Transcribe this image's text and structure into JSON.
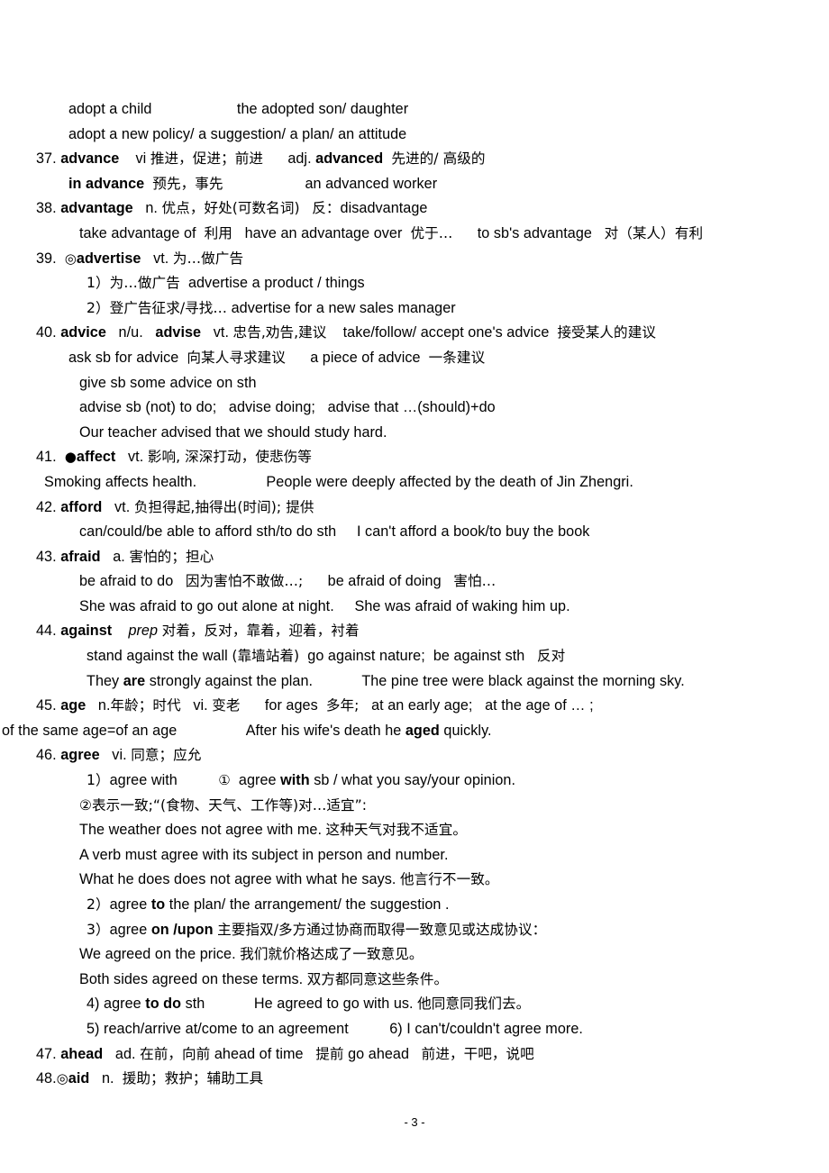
{
  "document": {
    "title": "English Vocabulary Notes",
    "page_label": "- 3 -",
    "entry_range": "37-48"
  },
  "lines": [
    {
      "id": "l01",
      "indent": 2,
      "text": "adopt a child                      the adopted son/ daughter"
    },
    {
      "id": "l02",
      "indent": 2,
      "text": "adopt a new policy/ a suggestion/ a plan/ an attitude"
    },
    {
      "id": "l03",
      "indent": 0,
      "text": "37. advance    vi 推进，促进；前进        adj. advanced  先进的/ 高级的"
    },
    {
      "id": "l04",
      "indent": 2,
      "text": "in advance  预先，事先                    an advanced worker"
    },
    {
      "id": "l05",
      "indent": 0,
      "text": "38. advantage   n. 优点，好处(可数名词)    反：disadvantage"
    },
    {
      "id": "l06",
      "indent": 3,
      "text": "take advantage of  利用   have an advantage over  优于…      to sb's advantage   对（某人）有利"
    },
    {
      "id": "l07",
      "indent": 0,
      "text": "39. ◎advertise   vt. 为…做广告"
    },
    {
      "id": "l08",
      "indent": 4,
      "text": "1）为…做广告  advertise a product / things"
    },
    {
      "id": "l09",
      "indent": 4,
      "text": "2）登广告征求/寻找… advertise for a new sales manager"
    },
    {
      "id": "l10",
      "indent": 0,
      "text": "40. advice   n/u.   advise   vt. 忠告,劝告,建议    take/follow/ accept one's advice  接受某人的建议"
    },
    {
      "id": "l11",
      "indent": 2,
      "text": "ask sb for advice  向某人寻求建议      a piece of advice  一条建议"
    },
    {
      "id": "l12",
      "indent": 3,
      "text": "give sb some advice on sth"
    },
    {
      "id": "l13",
      "indent": 3,
      "text": "advise sb (not) to do;   advise doing;   advise that …(should)+do"
    },
    {
      "id": "l14",
      "indent": 3,
      "text": "Our teacher advised that we should study hard."
    },
    {
      "id": "l15",
      "indent": 0,
      "text": "41.  ●affect   vt. 影响, 深深打动，使悲伤等"
    },
    {
      "id": "l16",
      "indent": 1,
      "text": "Smoking affects health.                 People were deeply affected by the death of Jin Zhengri."
    },
    {
      "id": "l17",
      "indent": 0,
      "text": "42. afford   vt. 负担得起,抽得出(时间); 提供"
    },
    {
      "id": "l18",
      "indent": 3,
      "text": "can/could/be able to afford sth/to do sth     I can't afford a book/to buy the book"
    },
    {
      "id": "l19",
      "indent": 0,
      "text": "43. afraid   a. 害怕的；担心"
    },
    {
      "id": "l20",
      "indent": 3,
      "text": "be afraid to do   因为害怕不敢做…;      be afraid of doing   害怕…"
    },
    {
      "id": "l21",
      "indent": 3,
      "text": "She was afraid to go out alone at night.     She was afraid of waking him up."
    },
    {
      "id": "l22",
      "indent": 0,
      "text": "44. against    prep 对着，反对，靠着，迎着，衬着"
    },
    {
      "id": "l23",
      "indent": 4,
      "text": "stand against the wall (靠墙站着)  go against nature;  be against sth   反对"
    },
    {
      "id": "l24",
      "indent": 4,
      "text": "They are strongly against the plan.            The pine tree were black against the morning sky."
    },
    {
      "id": "l25",
      "indent": 0,
      "text": "45. age   n.年龄；时代   vi. 变老      for ages  多年;   at an early age;   at the age of … ;"
    },
    {
      "id": "l26",
      "indent": -1,
      "text": "of the same age=of an age                 After his wife's death he aged quickly."
    },
    {
      "id": "l27",
      "indent": 0,
      "text": "46. agree   vi. 同意；应允"
    },
    {
      "id": "l28",
      "indent": 4,
      "text": "1）agree with          ①  agree with sb / what you say/your opinion."
    },
    {
      "id": "l29",
      "indent": 3,
      "text": "②表示一致;“(食物、天气、工作等)对…适宜”:"
    },
    {
      "id": "l30",
      "indent": 3,
      "text": "The weather does not agree with me. 这种天气对我不适宜。"
    },
    {
      "id": "l31",
      "indent": 3,
      "text": "A verb must agree with its subject in person and number."
    },
    {
      "id": "l32",
      "indent": 3,
      "text": "What he does does not agree with what he says. 他言行不一致。"
    },
    {
      "id": "l33",
      "indent": 4,
      "text": "2）agree to the plan/ the arrangement/ the suggestion ."
    },
    {
      "id": "l34",
      "indent": 4,
      "text": "3）agree on /upon 主要指双/多方通过协商而取得一致意见或达成协议："
    },
    {
      "id": "l35",
      "indent": 3,
      "text": "We agreed on the price. 我们就价格达成了一致意见。"
    },
    {
      "id": "l36",
      "indent": 3,
      "text": "Both sides agreed on these terms. 双方都同意这些条件。"
    },
    {
      "id": "l37",
      "indent": 4,
      "text": "4) agree to do sth            He agreed to go with us. 他同意同我们去。"
    },
    {
      "id": "l38",
      "indent": 4,
      "text": "5) reach/arrive at/come to an agreement          6) I can't/couldn't agree more."
    },
    {
      "id": "l39",
      "indent": 0,
      "text": "47. ahead   ad. 在前，向前 ahead of time   提前 go ahead   前进，干吧，说吧"
    },
    {
      "id": "l40",
      "indent": 0,
      "text": "48.◎aid   n.  援助；救护；辅助工具"
    }
  ],
  "entries": [
    {
      "number": "37",
      "headword": "advance",
      "pos": "vi",
      "meaning_cn": "推进，促进；前进",
      "extras": [
        "adj. advanced  先进的/ 高级的",
        "in advance  预先，事先",
        "an advanced worker"
      ]
    },
    {
      "number": "38",
      "headword": "advantage",
      "pos": "n.",
      "meaning_cn": "优点，好处(可数名词)",
      "extras": [
        "反：disadvantage",
        "take advantage of  利用",
        "have an advantage over  优于…",
        "to sb's advantage  对（某人）有利"
      ]
    },
    {
      "number": "39",
      "headword": "advertise",
      "marker": "◎",
      "pos": "vt.",
      "meaning_cn": "为…做广告",
      "extras": [
        "1）为…做广告  advertise a product / things",
        "2）登广告征求/寻找… advertise for a new sales manager"
      ]
    },
    {
      "number": "40",
      "headword": "advice",
      "pos": "n/u.",
      "meaning_cn": "忠告,劝告,建议",
      "extras": [
        "advise  vt.",
        "take/follow/ accept one's advice  接受某人的建议",
        "ask sb for advice  向某人寻求建议",
        "a piece of advice  一条建议",
        "give sb some advice on sth",
        "advise sb (not) to do;",
        "advise doing;",
        "advise that …(should)+do",
        "Our teacher advised that we should study hard."
      ]
    },
    {
      "number": "41",
      "headword": "affect",
      "marker": "●",
      "pos": "vt.",
      "meaning_cn": "影响, 深深打动，使悲伤等",
      "extras": [
        "Smoking affects health.",
        "People were deeply affected by the death of Jin Zhengri."
      ]
    },
    {
      "number": "42",
      "headword": "afford",
      "pos": "vt.",
      "meaning_cn": "负担得起,抽得出(时间); 提供",
      "extras": [
        "can/could/be able to afford sth/to do sth",
        "I can't afford a book/to buy the book"
      ]
    },
    {
      "number": "43",
      "headword": "afraid",
      "pos": "a.",
      "meaning_cn": "害怕的；担心",
      "extras": [
        "be afraid to do  因为害怕不敢做…;",
        "be afraid of doing  害怕…",
        "She was afraid to go out alone at night.",
        "She was afraid of waking him up."
      ]
    },
    {
      "number": "44",
      "headword": "against",
      "pos": "prep",
      "meaning_cn": "对着，反对，靠着，迎着，衬着",
      "extras": [
        "stand against the wall (靠墙站着)",
        "go against nature;",
        "be against sth  反对",
        "They are strongly against the plan.",
        "The pine tree were black against the morning sky."
      ]
    },
    {
      "number": "45",
      "headword": "age",
      "pos": "n.",
      "meaning_cn": "年龄；时代",
      "extras": [
        "vi. 变老",
        "for ages  多年;",
        "at an early age;",
        "at the age of … ;",
        "of the same age=of an age",
        "After his wife's death he aged quickly."
      ]
    },
    {
      "number": "46",
      "headword": "agree",
      "pos": "vi.",
      "meaning_cn": "同意；应允",
      "extras": [
        "1）agree with",
        "① agree with sb / what you say/your opinion.",
        "②表示一致;“(食物、天气、工作等)对…适宜”:",
        "The weather does not agree with me. 这种天气对我不适宜。",
        "A verb must agree with its subject in person and number.",
        "What he does does not agree with what he says. 他言行不一致。",
        "2）agree to the plan/ the arrangement/ the suggestion .",
        "3）agree on /upon 主要指双/多方通过协商而取得一致意见或达成协议：",
        "We agreed on the price. 我们就价格达成了一致意见。",
        "Both sides agreed on these terms. 双方都同意这些条件。",
        "4) agree to do sth",
        "He agreed to go with us. 他同意同我们去。",
        "5) reach/arrive at/come to an agreement",
        "6) I can't/couldn't agree more."
      ]
    },
    {
      "number": "47",
      "headword": "ahead",
      "pos": "ad.",
      "meaning_cn": "在前，向前",
      "extras": [
        "ahead of time  提前",
        "go ahead  前进，干吧，说吧"
      ]
    },
    {
      "number": "48",
      "headword": "aid",
      "marker": "◎",
      "pos": "n.",
      "meaning_cn": "援助；救护；辅助工具",
      "extras": []
    }
  ],
  "segments": {
    "l01": [
      {
        "t": "adopt a child",
        "b": false
      },
      {
        "t": "                      ",
        "b": false
      },
      {
        "t": "the adopted son/ daughter",
        "b": false
      }
    ],
    "l03_num": "37.",
    "l03_head": "advance",
    "l05_head": "advantage",
    "l07_head": "advertise",
    "l10_head": "advice",
    "l10_head2": "advise",
    "l15_head": "affect",
    "l17_head": "afford",
    "l19_head": "afraid",
    "l22_head": "against",
    "l25_head": "age",
    "l27_head": "agree",
    "l39_head": "ahead",
    "l40_head": "aid"
  }
}
